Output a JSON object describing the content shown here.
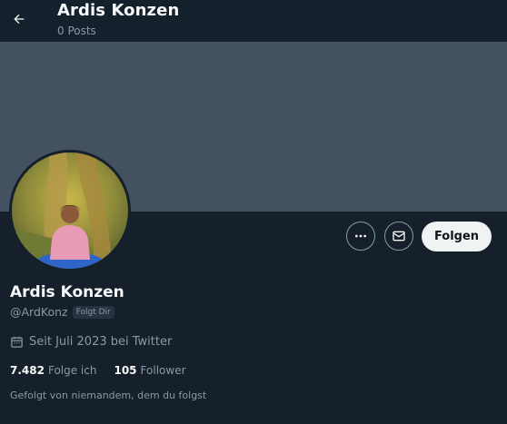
{
  "header": {
    "title": "Ardis Konzen",
    "subtitle": "0 Posts"
  },
  "profile": {
    "name": "Ardis Konzen",
    "handle": "@ArdKonz",
    "follows_you_badge": "Folgt Dir",
    "joined": "Seit Juli 2023 bei Twitter",
    "following_count": "7.482",
    "following_label": "Folge ich",
    "followers_count": "105",
    "followers_label": "Follower",
    "followed_by": "Gefolgt von niemandem, dem du folgst"
  },
  "actions": {
    "more_icon": "more-horizontal-icon",
    "message_icon": "mail-icon",
    "follow_label": "Folgen"
  },
  "icons": {
    "back": "arrow-left-icon",
    "calendar": "calendar-icon"
  },
  "colors": {
    "background": "#15202b",
    "banner": "#435160",
    "text_primary": "#f7f9f9",
    "text_secondary": "#8b98a5",
    "follow_button_bg": "#eff3f4"
  }
}
